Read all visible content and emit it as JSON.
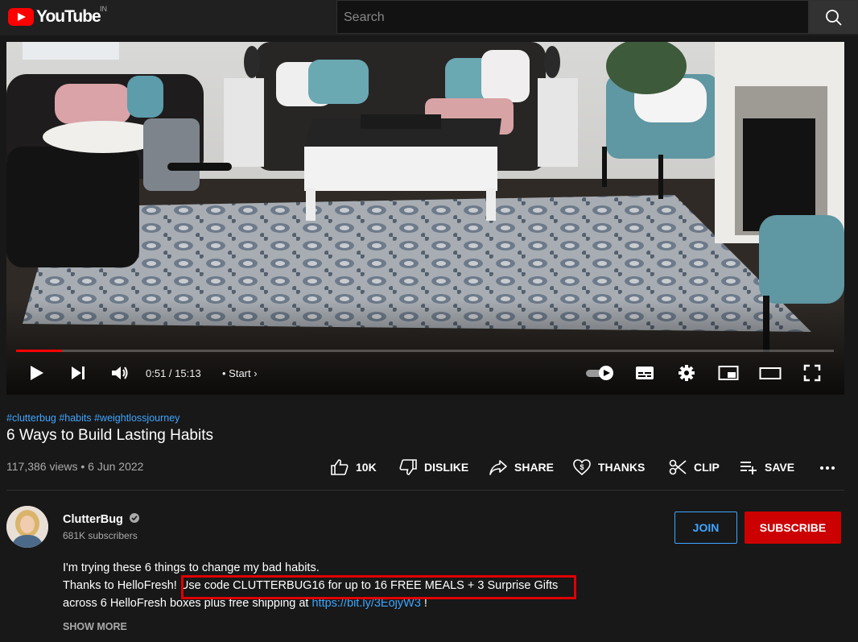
{
  "header": {
    "logo_text": "YouTube",
    "region": "IN",
    "search_placeholder": "Search"
  },
  "player": {
    "current_time": "0:51",
    "duration": "15:13",
    "time_separator": " / ",
    "chapter": "Start",
    "progress_fraction": 0.056
  },
  "video": {
    "hashtags": "#clutterbug #habits #weightlossjourney",
    "title": "6 Ways to Build Lasting Habits",
    "views": "117,386 views",
    "date": "6 Jun 2022"
  },
  "actions": {
    "like": "10K",
    "dislike": "DISLIKE",
    "share": "SHARE",
    "thanks": "THANKS",
    "clip": "CLIP",
    "save": "SAVE"
  },
  "channel": {
    "name": "ClutterBug",
    "subscribers": "681K subscribers",
    "join_label": "JOIN",
    "subscribe_label": "SUBSCRIBE"
  },
  "description": {
    "line1": "I'm trying these 6 things to change my bad habits.",
    "line2_prefix": "Thanks to HelloFresh! ",
    "line2_highlight": "Use code CLUTTERBUG16 for up to 16 FREE MEALS + 3 Surprise Gifts",
    "line3_prefix": "across 6 HelloFresh boxes plus free shipping at ",
    "line3_link": "https://bit.ly/3EojyW3",
    "line3_suffix": " !",
    "show_more": "SHOW MORE"
  },
  "colors": {
    "accent_red": "#ff0000",
    "subscribe_red": "#cc0000",
    "link_blue": "#3ea6ff",
    "highlight_box": "#e00000"
  }
}
